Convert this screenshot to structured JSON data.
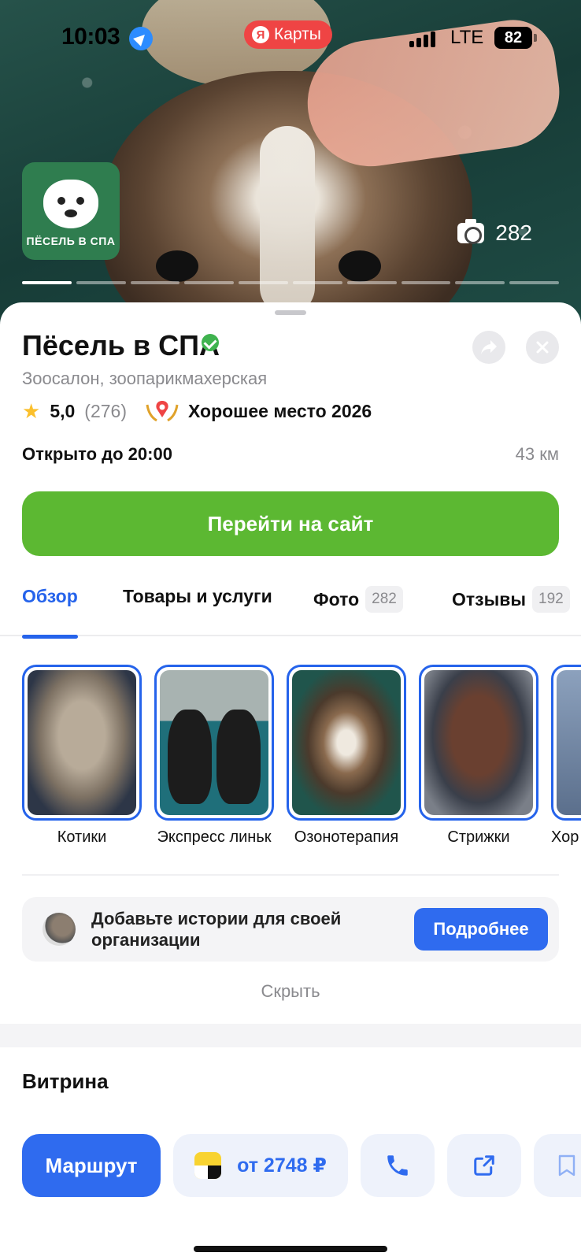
{
  "status_bar": {
    "time": "10:03",
    "back_app": "Карты",
    "back_app_badge": "Я",
    "network": "LTE",
    "battery": "82"
  },
  "hero": {
    "photo_count": "282",
    "logo_text": "ПЁСЕЛЬ В СПА",
    "pager_total": 10,
    "pager_active_index": 0
  },
  "place": {
    "name": "Пёсель в СПА",
    "category": "Зоосалон, зоопарикмахерская",
    "rating": "5,0",
    "rating_count": "(276)",
    "award": "Хорошее место 2026",
    "hours": "Открыто до 20:00",
    "distance": "43 км",
    "site_button": "Перейти на сайт"
  },
  "tabs": [
    {
      "label": "Обзор",
      "count": "",
      "active": true
    },
    {
      "label": "Товары и услуги",
      "count": ""
    },
    {
      "label": "Фото",
      "count": "282"
    },
    {
      "label": "Отзывы",
      "count": "192"
    }
  ],
  "stories": [
    {
      "label": "Котики"
    },
    {
      "label": "Экспресс линьк"
    },
    {
      "label": "Озонотерапия"
    },
    {
      "label": "Стрижки"
    },
    {
      "label": "Хор"
    }
  ],
  "promo": {
    "text": "Добавьте истории для своей организации",
    "button": "Подробнее",
    "hide": "Скрыть"
  },
  "sections": {
    "showcase_title": "Витрина"
  },
  "actions": {
    "route": "Маршрут",
    "taxi_price": "от 2748 ₽"
  },
  "colors": {
    "accent_blue": "#2f6bef",
    "site_green": "#5cb832",
    "maps_red": "#ef4444",
    "verified_green": "#3fb34f"
  },
  "icons": [
    "location-arrow-icon",
    "camera-icon",
    "verified-icon",
    "share-icon",
    "close-icon",
    "star-icon",
    "award-icon",
    "taxi-icon",
    "phone-icon",
    "open-external-icon",
    "bookmark-icon"
  ]
}
